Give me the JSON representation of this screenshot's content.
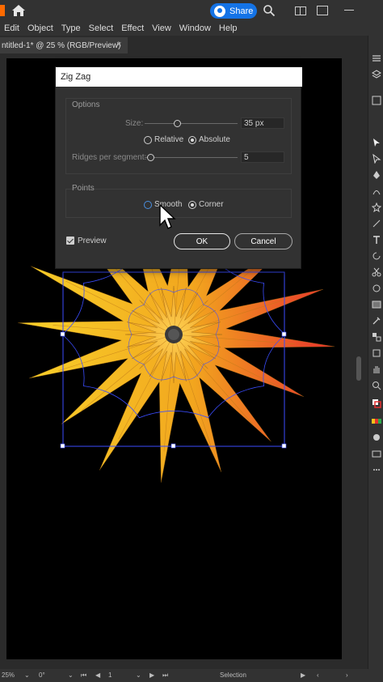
{
  "topbar": {
    "share_label": "Share",
    "icons": [
      "home-icon",
      "search-icon",
      "workspace-icon",
      "window-icon",
      "minimize-icon"
    ]
  },
  "menu": {
    "items": [
      "Edit",
      "Object",
      "Type",
      "Select",
      "Effect",
      "View",
      "Window",
      "Help"
    ]
  },
  "document_tab": {
    "title": "ntitled-1* @ 25 % (RGB/Preview)",
    "close_glyph": "×"
  },
  "dialog": {
    "title": "Zig Zag",
    "options_group": "Options",
    "size_label": "Size:",
    "size_value": "35 px",
    "size_slider_fraction": 0.35,
    "relative_label": "Relative",
    "absolute_label": "Absolute",
    "ridges_label": "Ridges per segment:",
    "ridges_value": "5",
    "ridges_slider_fraction": 0.05,
    "points_group": "Points",
    "smooth_label": "Smooth",
    "corner_label": "Corner",
    "preview_label": "Preview",
    "ok_label": "OK",
    "cancel_label": "Cancel",
    "selected_mode": "Absolute",
    "selected_point": "Corner",
    "preview_checked": true
  },
  "statusbar": {
    "zoom": "25%",
    "rotation": "0°",
    "artboard_number": "1",
    "tool_name": "Selection"
  },
  "colors": {
    "accent": "#1473e6",
    "star_yellow": "#f5c21b",
    "star_orange": "#f08a1e",
    "star_red": "#e8322c",
    "selection_blue": "#3b4dff"
  }
}
